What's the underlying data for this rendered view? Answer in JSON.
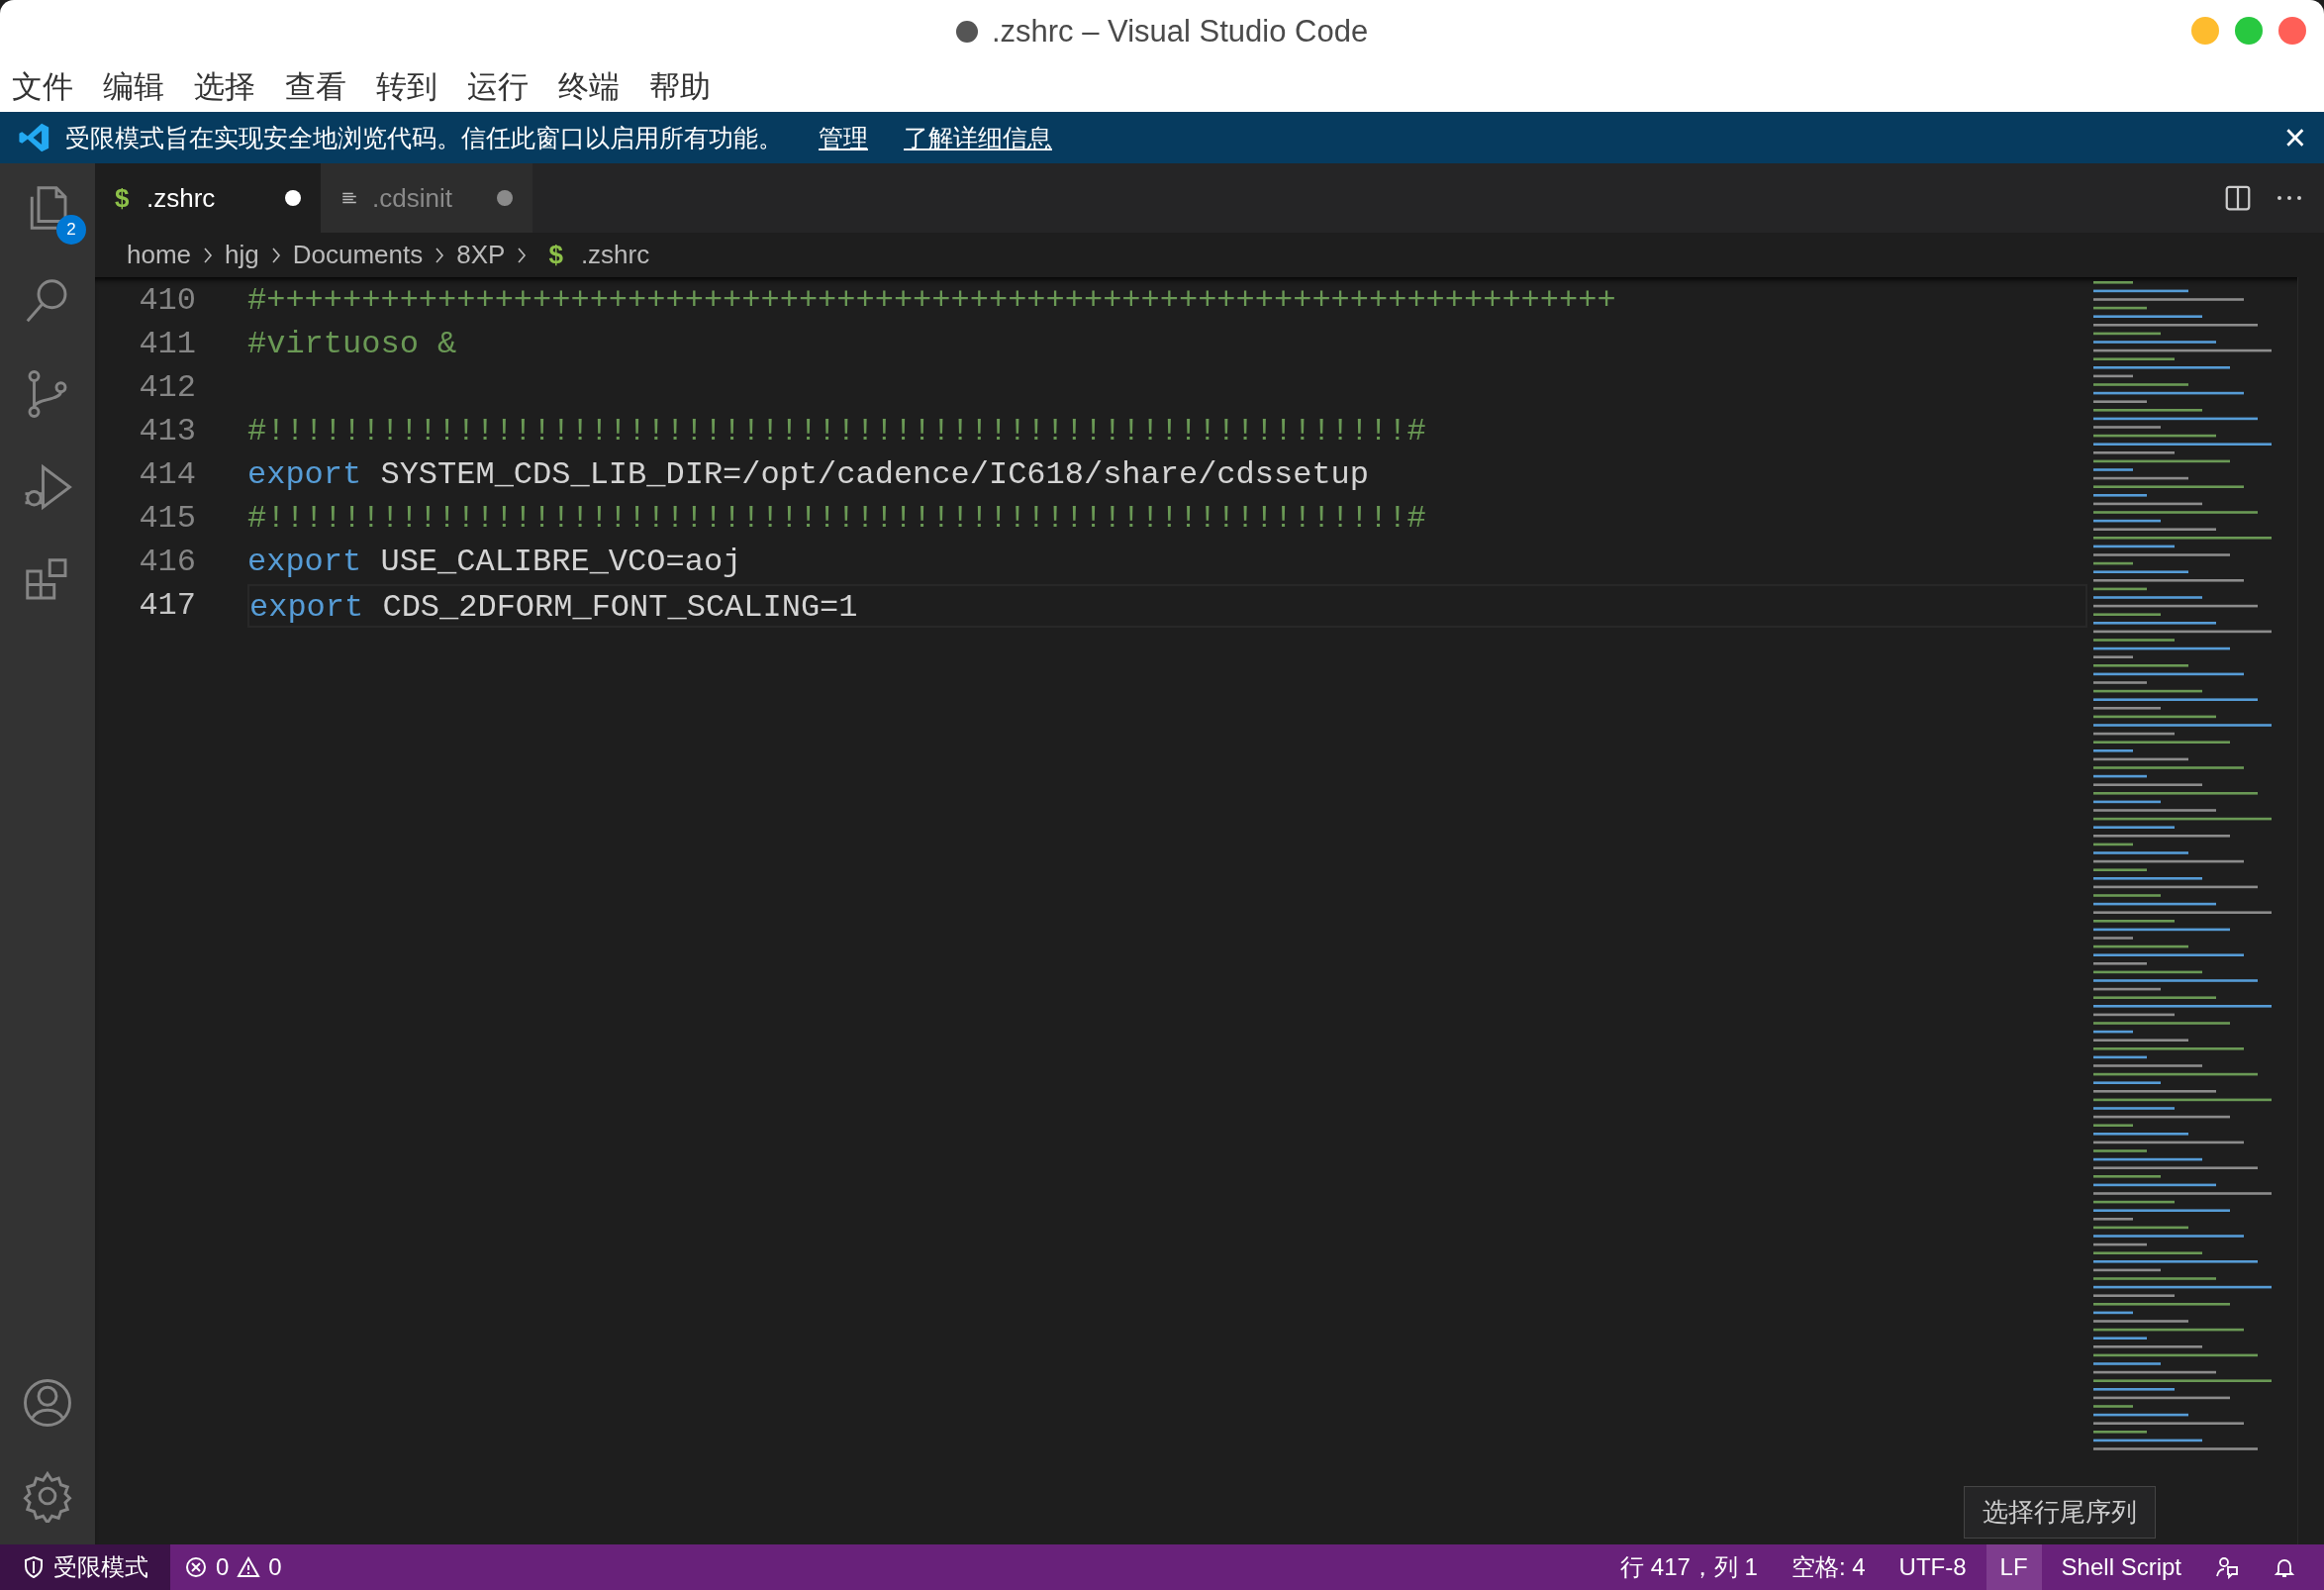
{
  "window": {
    "title": ".zshrc – Visual Studio Code",
    "dirty": true
  },
  "menu": [
    "文件",
    "编辑",
    "选择",
    "查看",
    "转到",
    "运行",
    "终端",
    "帮助"
  ],
  "banner": {
    "message": "受限模式旨在实现安全地浏览代码。信任此窗口以启用所有功能。",
    "links": [
      "管理",
      "了解详细信息"
    ],
    "close": "×"
  },
  "activity_bar": [
    {
      "kind": "explorer",
      "badge": "2"
    },
    {
      "kind": "search"
    },
    {
      "kind": "source-control"
    },
    {
      "kind": "run-debug"
    },
    {
      "kind": "extensions"
    },
    {
      "kind": "account"
    },
    {
      "kind": "settings"
    }
  ],
  "tabs": [
    {
      "kind": "shell",
      "icon": "$",
      "label": ".zshrc",
      "selected": true,
      "dirty": true
    },
    {
      "kind": "text",
      "label": ".cdsinit",
      "selected": false,
      "dirty": true
    }
  ],
  "breadcrumbs": {
    "parts": [
      "home",
      "hjg",
      "Documents",
      "8XP"
    ],
    "file": {
      "icon": "$",
      "label": ".zshrc"
    }
  },
  "lines": [
    {
      "number": "410",
      "current": false,
      "tokens": [
        {
          "kind": "comment",
          "text": "#+++++++++++++++++++++++++++++++++++++++++++++++++++++++++++++++++++++++"
        }
      ]
    },
    {
      "number": "411",
      "current": false,
      "tokens": [
        {
          "kind": "comment",
          "text": "#virtuoso &"
        }
      ]
    },
    {
      "number": "412",
      "current": false
    },
    {
      "number": "413",
      "current": false,
      "tokens": [
        {
          "kind": "comment",
          "text": "#!!!!!!!!!!!!!!!!!!!!!!!!!!!!!!!!!!!!!!!!!!!!!!!!!!!!!!!!!!!!#"
        }
      ]
    },
    {
      "number": "414",
      "current": false,
      "tokens": [
        {
          "kind": "keyword",
          "text": "export"
        },
        {
          "kind": "plain",
          "text": " SYSTEM_CDS_LIB_DIR=/opt/cadence/IC618/share/cdssetup"
        }
      ]
    },
    {
      "number": "415",
      "current": false,
      "tokens": [
        {
          "kind": "comment",
          "text": "#!!!!!!!!!!!!!!!!!!!!!!!!!!!!!!!!!!!!!!!!!!!!!!!!!!!!!!!!!!!!#"
        }
      ]
    },
    {
      "number": "416",
      "current": false,
      "tokens": [
        {
          "kind": "keyword",
          "text": "export"
        },
        {
          "kind": "plain",
          "text": " USE_CALIBRE_VCO=aoj"
        }
      ]
    },
    {
      "number": "417",
      "current": true,
      "tokens": [
        {
          "kind": "keyword",
          "text": "export"
        },
        {
          "kind": "plain",
          "text": " CDS_2DFORM_FONT_SCALING=1"
        }
      ]
    }
  ],
  "tooltip": "选择行尾序列",
  "status_bar": {
    "left": [
      {
        "kind": "restricted",
        "label": "受限模式"
      },
      {
        "kind": "problems",
        "errors": "0",
        "warnings": "0"
      }
    ],
    "right": [
      {
        "kind": "text",
        "label": "行 417，列 1",
        "hovered": false
      },
      {
        "kind": "text",
        "label": "空格: 4",
        "hovered": false
      },
      {
        "kind": "text",
        "label": "UTF-8",
        "hovered": false
      },
      {
        "kind": "text",
        "label": "LF",
        "hovered": true
      },
      {
        "kind": "text",
        "label": "Shell Script",
        "hovered": false
      },
      {
        "kind": "feedback"
      },
      {
        "kind": "notifications"
      }
    ]
  }
}
